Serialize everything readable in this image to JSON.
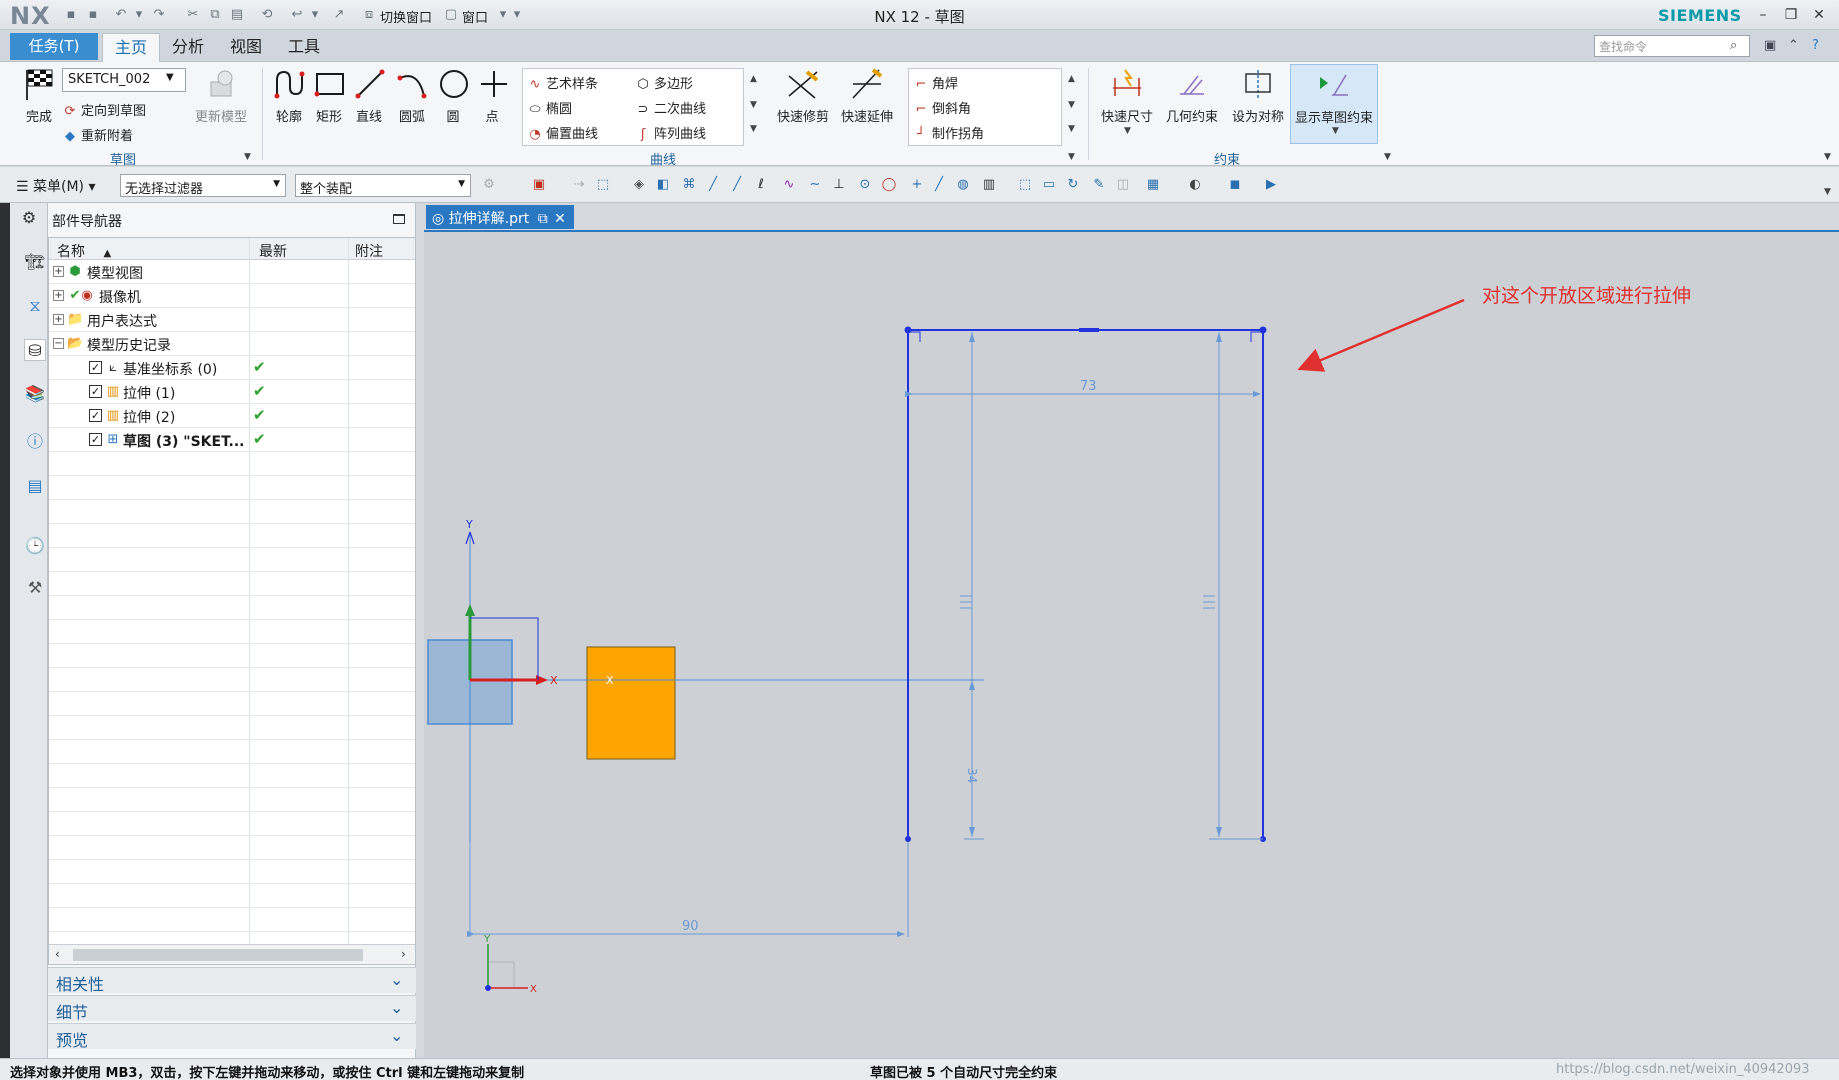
{
  "titlebar": {
    "logo": "NX",
    "switch_window": "切换窗口",
    "window_menu": "窗口",
    "title": "NX 12 - 草图",
    "brand": "SIEMENS"
  },
  "tabs": {
    "task": "任务(T)",
    "items": [
      {
        "label": "主页",
        "active": true
      },
      {
        "label": "分析",
        "active": false
      },
      {
        "label": "视图",
        "active": false
      },
      {
        "label": "工具",
        "active": false
      }
    ],
    "search_placeholder": "查找命令"
  },
  "ribbon": {
    "sketch_group": {
      "finish": "完成",
      "sketch_name": "SKETCH_002",
      "orient": "定向到草图",
      "reattach": "重新附着",
      "update_model": "更新模型",
      "label": "草图"
    },
    "curve_group": {
      "profile": "轮廓",
      "rectangle": "矩形",
      "line": "直线",
      "arc": "圆弧",
      "circle": "圆",
      "point": "点",
      "gallery": [
        "艺术样条",
        "多边形",
        "椭圆",
        "二次曲线",
        "偏置曲线",
        "阵列曲线"
      ],
      "quick_trim": "快速修剪",
      "quick_extend": "快速延伸",
      "corner_gallery": [
        "角焊",
        "倒斜角",
        "制作拐角"
      ],
      "label": "曲线"
    },
    "constraint_group": {
      "rapid_dim": "快速尺寸",
      "geom_constraint": "几何约束",
      "make_symmetric": "设为对称",
      "show_constraints": "显示草图约束",
      "label": "约束"
    }
  },
  "selbar": {
    "menu": "菜单(M)",
    "filter": "无选择过滤器",
    "scope": "整个装配"
  },
  "navigator": {
    "title": "部件导航器",
    "columns": [
      "名称",
      "最新",
      "附注"
    ],
    "rows": [
      {
        "label": "模型视图",
        "level": 0,
        "expander": "+",
        "icon": "model-views-icon",
        "check": false,
        "latest": false
      },
      {
        "label": "摄像机",
        "level": 0,
        "expander": "+",
        "icon": "camera-icon",
        "check": false,
        "latest": false,
        "green_check": true
      },
      {
        "label": "用户表达式",
        "level": 0,
        "expander": "+",
        "icon": "folder-icon",
        "check": false,
        "latest": false
      },
      {
        "label": "模型历史记录",
        "level": 0,
        "expander": "−",
        "icon": "folder-icon",
        "check": false,
        "latest": false
      },
      {
        "label": "基准坐标系 (0)",
        "level": 1,
        "icon": "datum-csys-icon",
        "check": true,
        "latest": true
      },
      {
        "label": "拉伸 (1)",
        "level": 1,
        "icon": "extrude-icon",
        "check": true,
        "latest": true
      },
      {
        "label": "拉伸 (2)",
        "level": 1,
        "icon": "extrude-icon",
        "check": true,
        "latest": true
      },
      {
        "label": "草图 (3) \"SKET...",
        "level": 1,
        "icon": "sketch-icon",
        "check": true,
        "latest": true,
        "bold": true
      }
    ],
    "latest_mark": "✔",
    "sections": [
      "相关性",
      "细节",
      "预览"
    ]
  },
  "document": {
    "tab": "拉伸详解.prt"
  },
  "sketch": {
    "annotation": "对这个开放区域进行拉伸",
    "dim_width": "73",
    "dim_height": "34",
    "dim_offset": "90",
    "axis_x": "X",
    "axis_y": "Y",
    "accent": "#2233dd",
    "block_color": "#ffa500"
  },
  "status": {
    "prompt": "选择对象并使用 MB3，双击，按下左键并拖动来移动，或按住 Ctrl 键和左键拖动来复制",
    "message": "草图已被 5 个自动尺寸完全约束",
    "watermark": "https://blog.csdn.net/weixin_40942093"
  }
}
